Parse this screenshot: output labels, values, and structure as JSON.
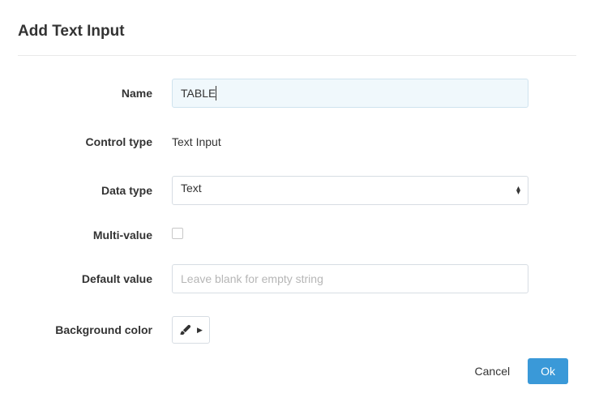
{
  "dialog": {
    "title": "Add Text Input"
  },
  "form": {
    "name": {
      "label": "Name",
      "value": "TABLE"
    },
    "control_type": {
      "label": "Control type",
      "value": "Text Input"
    },
    "data_type": {
      "label": "Data type",
      "value": "Text"
    },
    "multi_value": {
      "label": "Multi-value",
      "checked": false
    },
    "default_value": {
      "label": "Default value",
      "placeholder": "Leave blank for empty string",
      "value": ""
    },
    "background_color": {
      "label": "Background color"
    }
  },
  "footer": {
    "cancel": "Cancel",
    "ok": "Ok"
  }
}
